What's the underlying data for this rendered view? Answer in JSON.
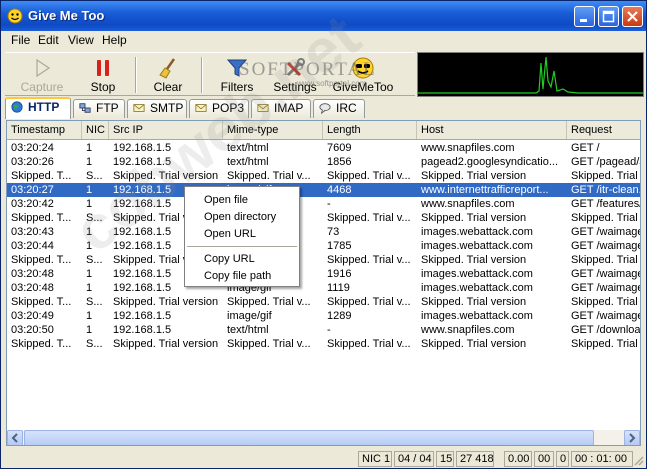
{
  "window": {
    "title": "Give Me Too"
  },
  "menu": [
    "File",
    "Edit",
    "View",
    "Help"
  ],
  "toolbar": {
    "capture": "Capture",
    "stop": "Stop",
    "clear": "Clear",
    "filters": "Filters",
    "settings": "Settings",
    "givemetoo": "GiveMeToo"
  },
  "watermarks": {
    "softportal": "SOFTPORTAL",
    "softportal_sub": "www.softportal.com",
    "diagonal": "cobweb.net"
  },
  "tabs": [
    "HTTP",
    "FTP",
    "SMTP",
    "POP3",
    "IMAP",
    "IRC"
  ],
  "active_tab": "HTTP",
  "columns": [
    "Timestamp",
    "NIC",
    "Src IP",
    "Mime-type",
    "Length",
    "Host",
    "Request"
  ],
  "rows": [
    {
      "ts": "03:20:24",
      "nic": "1",
      "src": "192.168.1.5",
      "mime": "text/html",
      "len": "7609",
      "host": "www.snapfiles.com",
      "req": "GET /"
    },
    {
      "ts": "03:20:26",
      "nic": "1",
      "src": "192.168.1.5",
      "mime": "text/html",
      "len": "1856",
      "host": "pagead2.googlesyndicatio...",
      "req": "GET /pagead/a"
    },
    {
      "ts": "Skipped. T...",
      "nic": "S...",
      "src": "Skipped. Trial version",
      "mime": "Skipped. Trial v...",
      "len": "Skipped. Trial v...",
      "host": "Skipped. Trial version",
      "req": "Skipped. Trial v"
    },
    {
      "ts": "03:20:27",
      "nic": "1",
      "src": "192.168.1.5",
      "mime": "image/gif",
      "len": "4468",
      "host": "www.internettrafficreport...",
      "req": "GET /itr-clean."
    },
    {
      "ts": "03:20:42",
      "nic": "1",
      "src": "192.168.1.5",
      "mime": "",
      "len": "-",
      "host": "www.snapfiles.com",
      "req": "GET /features/"
    },
    {
      "ts": "Skipped. T...",
      "nic": "S...",
      "src": "Skipped. Trial version",
      "mime": "",
      "len": "Skipped. Trial v...",
      "host": "Skipped. Trial version",
      "req": "Skipped. Trial v"
    },
    {
      "ts": "03:20:43",
      "nic": "1",
      "src": "192.168.1.5",
      "mime": "",
      "len": "73",
      "host": "images.webattack.com",
      "req": "GET /waimages"
    },
    {
      "ts": "03:20:44",
      "nic": "1",
      "src": "192.168.1.5",
      "mime": "",
      "len": "1785",
      "host": "images.webattack.com",
      "req": "GET /waimages"
    },
    {
      "ts": "Skipped. T...",
      "nic": "S...",
      "src": "Skipped. Trial version",
      "mime": "",
      "len": "Skipped. Trial v...",
      "host": "Skipped. Trial version",
      "req": "Skipped. Trial v"
    },
    {
      "ts": "03:20:48",
      "nic": "1",
      "src": "192.168.1.5",
      "mime": "",
      "len": "1916",
      "host": "images.webattack.com",
      "req": "GET /waimages"
    },
    {
      "ts": "03:20:48",
      "nic": "1",
      "src": "192.168.1.5",
      "mime": "image/gif",
      "len": "1119",
      "host": "images.webattack.com",
      "req": "GET /waimages"
    },
    {
      "ts": "Skipped. T...",
      "nic": "S...",
      "src": "Skipped. Trial version",
      "mime": "Skipped. Trial v...",
      "len": "Skipped. Trial v...",
      "host": "Skipped. Trial version",
      "req": "Skipped. Trial v"
    },
    {
      "ts": "03:20:49",
      "nic": "1",
      "src": "192.168.1.5",
      "mime": "image/gif",
      "len": "1289",
      "host": "images.webattack.com",
      "req": "GET /waimages"
    },
    {
      "ts": "03:20:50",
      "nic": "1",
      "src": "192.168.1.5",
      "mime": "text/html",
      "len": "-",
      "host": "www.snapfiles.com",
      "req": "GET /download"
    },
    {
      "ts": "Skipped. T...",
      "nic": "S...",
      "src": "Skipped. Trial version",
      "mime": "Skipped. Trial v...",
      "len": "Skipped. Trial v...",
      "host": "Skipped. Trial version",
      "req": "Skipped. Trial v"
    }
  ],
  "selected_row": 3,
  "context_menu": [
    "Open file",
    "Open directory",
    "Open URL",
    "Copy URL",
    "Copy file path"
  ],
  "status": {
    "nic": "NIC 1",
    "pages": "04 / 04",
    "count": "15",
    "bytes": "27 418",
    "rate1": "0.00",
    "rate2": "00",
    "rate3": "0",
    "time": "00 : 01: 00"
  },
  "colors": {
    "titlebar": "#0e4ac4",
    "selection": "#316ac5",
    "graph_bg": "#000000",
    "graph_line": "#22cc22"
  }
}
